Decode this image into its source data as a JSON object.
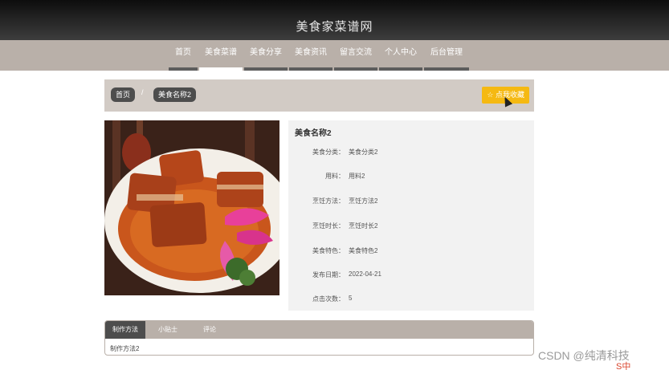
{
  "header": {
    "site_title": "美食家菜谱网"
  },
  "nav": {
    "items": [
      {
        "label": "首页"
      },
      {
        "label": "美食菜谱"
      },
      {
        "label": "美食分享"
      },
      {
        "label": "美食资讯"
      },
      {
        "label": "留言交流"
      },
      {
        "label": "个人中心"
      },
      {
        "label": "后台管理"
      }
    ],
    "active_index": 1
  },
  "breadcrumb": {
    "home": "首页",
    "current": "美食名称2",
    "separator": "/"
  },
  "favorite_button": {
    "label": "☆ 点我收藏"
  },
  "recipe": {
    "title": "美食名称2",
    "fields": [
      {
        "key": "美食分类：",
        "value": "美食分类2"
      },
      {
        "key": "用料：",
        "value": "用料2"
      },
      {
        "key": "烹饪方法：",
        "value": "烹饪方法2"
      },
      {
        "key": "烹饪时长：",
        "value": "烹饪时长2"
      },
      {
        "key": "美食特色：",
        "value": "美食特色2"
      },
      {
        "key": "发布日期：",
        "value": "2022-04-21"
      },
      {
        "key": "点击次数：",
        "value": "5"
      }
    ]
  },
  "tabs": {
    "items": [
      {
        "label": "制作方法"
      },
      {
        "label": "小贴士"
      },
      {
        "label": "评论"
      }
    ],
    "content": "制作方法2"
  },
  "watermark": {
    "text": "CSDN @纯清科技",
    "corner_text": "S中"
  },
  "colors": {
    "nav_bg": "#b9b0a9",
    "crumb_bg": "#d2cbc5",
    "accent": "#f5b912",
    "dark_pill": "#4d4d4d"
  }
}
